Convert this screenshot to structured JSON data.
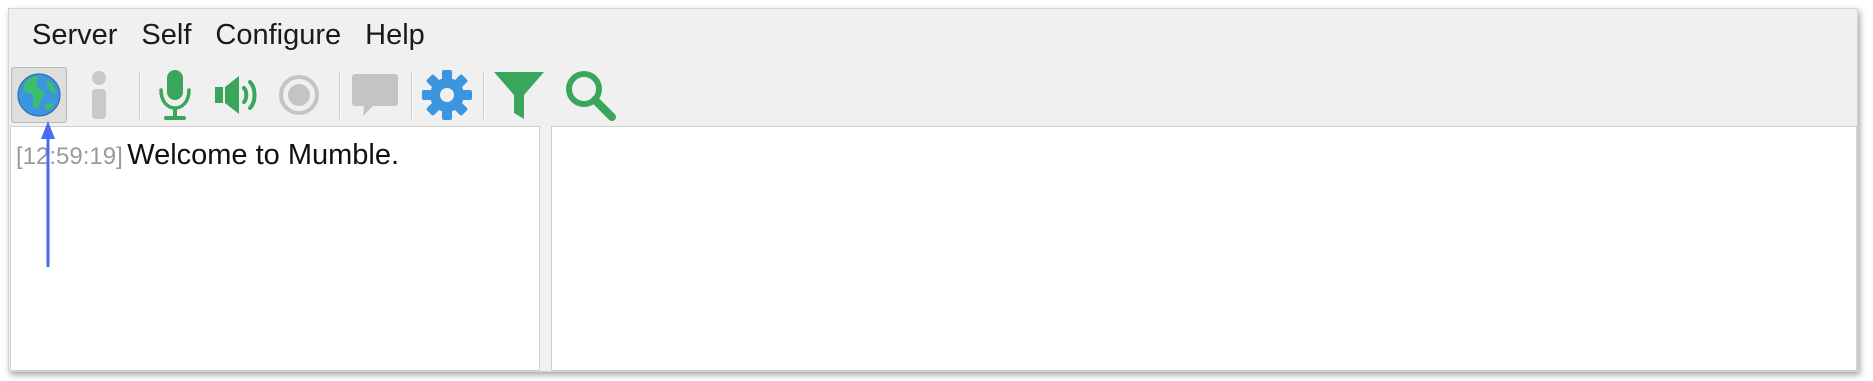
{
  "menu": {
    "server": "Server",
    "self": "Self",
    "configure": "Configure",
    "help": "Help"
  },
  "toolbar": {
    "buttons": [
      {
        "icon": "globe-icon",
        "name": "connect-button"
      },
      {
        "icon": "info-icon",
        "name": "info-button",
        "disabled": true
      },
      {
        "icon": "microphone-icon",
        "name": "mute-self-button"
      },
      {
        "icon": "speaker-icon",
        "name": "deafen-self-button"
      },
      {
        "icon": "record-icon",
        "name": "record-button",
        "disabled": true
      },
      {
        "icon": "chat-bubble-icon",
        "name": "text-message-button",
        "disabled": true
      },
      {
        "icon": "gear-icon",
        "name": "settings-button"
      },
      {
        "icon": "funnel-icon",
        "name": "filter-button"
      },
      {
        "icon": "magnifier-icon",
        "name": "search-button"
      }
    ]
  },
  "log": {
    "timestamp": "[12:59:19]",
    "message": "Welcome to Mumble."
  },
  "colors": {
    "green": "#3aa65b",
    "blue": "#3d95e0",
    "gray_disabled": "#c4c4c4",
    "arrow": "#4a6cf0"
  }
}
